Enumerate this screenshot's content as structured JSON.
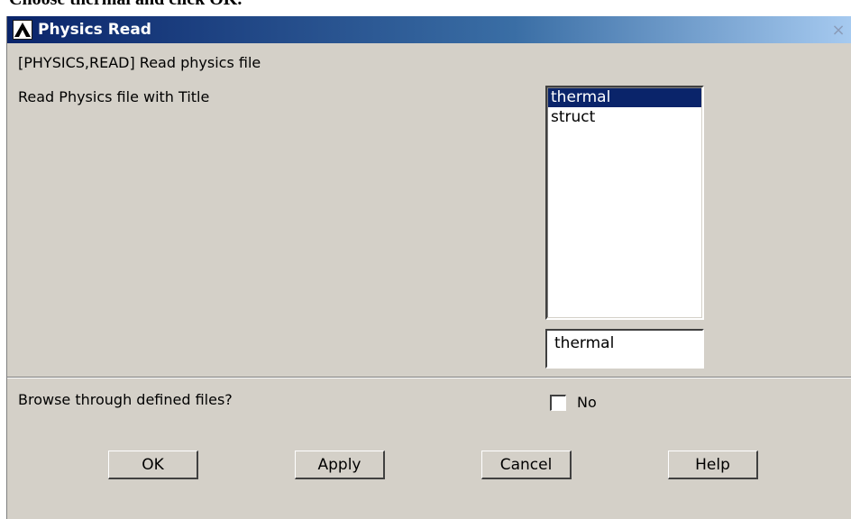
{
  "page_caption": "Choose thermal and click OK.",
  "window": {
    "title": "Physics Read",
    "close_symbol": "×",
    "icon": "ansys-logo-icon"
  },
  "dialog": {
    "command_label": "[PHYSICS,READ]  Read physics file",
    "read_label": "Read Physics file with Title",
    "list_items": [
      "thermal",
      "struct"
    ],
    "selected_item": "thermal",
    "input_value": "thermal",
    "browse_label": "Browse through defined files?",
    "checkbox_label": "No",
    "checkbox_checked": false
  },
  "buttons": {
    "ok": "OK",
    "apply": "Apply",
    "cancel": "Cancel",
    "help": "Help"
  },
  "colors": {
    "titlebar": "#0a246a",
    "dialog_bg": "#d4d0c8",
    "selection": "#0a246a"
  }
}
